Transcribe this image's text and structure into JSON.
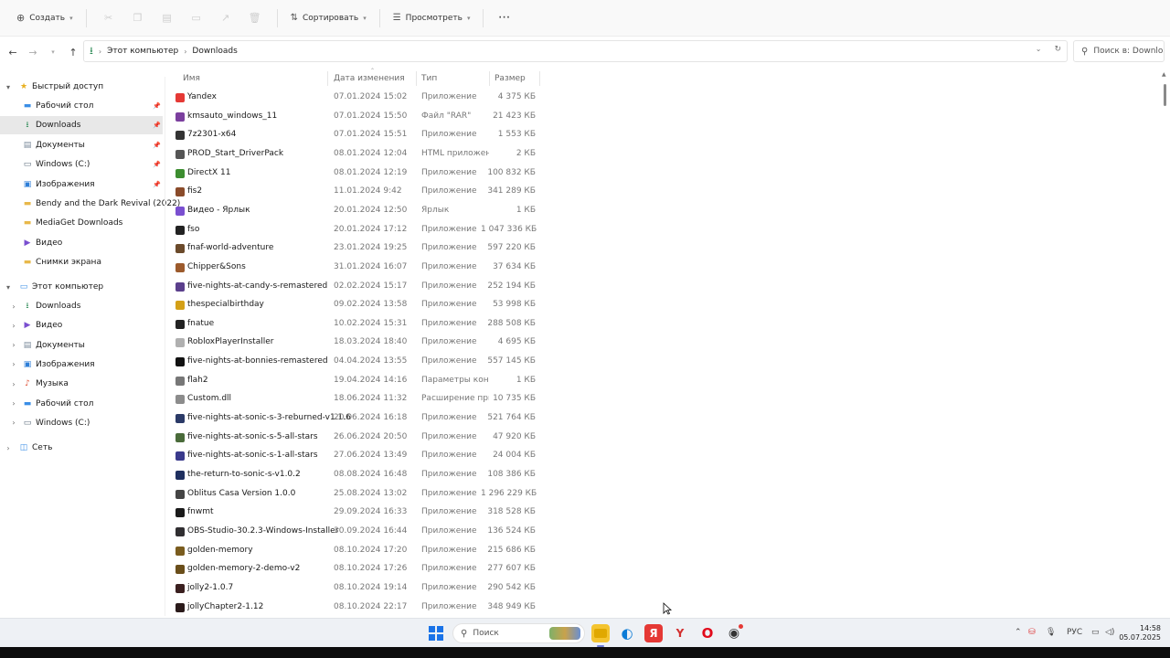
{
  "toolbar": {
    "create_label": "Создать",
    "sort_label": "Сортировать",
    "view_label": "Просмотреть",
    "more_label": "···"
  },
  "address": {
    "crumbs": [
      "Этот компьютер",
      "Downloads"
    ],
    "search_placeholder": "Поиск в: Downloads"
  },
  "sidebar": {
    "quick_access": "Быстрый доступ",
    "quick_items": [
      {
        "label": "Рабочий стол",
        "icon": "desktop-icon"
      },
      {
        "label": "Downloads",
        "icon": "download-icon"
      },
      {
        "label": "Документы",
        "icon": "documents-icon"
      },
      {
        "label": "Windows (C:)",
        "icon": "drive-icon"
      },
      {
        "label": "Изображения",
        "icon": "pictures-icon"
      },
      {
        "label": "Bendy and the Dark Revival (2022)",
        "icon": "folder-icon"
      },
      {
        "label": "MediaGet Downloads",
        "icon": "folder-icon"
      },
      {
        "label": "Видео",
        "icon": "video-icon"
      },
      {
        "label": "Снимки экрана",
        "icon": "folder-icon"
      }
    ],
    "this_pc": "Этот компьютер",
    "pc_items": [
      {
        "label": "Downloads",
        "icon": "download-icon"
      },
      {
        "label": "Видео",
        "icon": "video-icon"
      },
      {
        "label": "Документы",
        "icon": "documents-icon"
      },
      {
        "label": "Изображения",
        "icon": "pictures-icon"
      },
      {
        "label": "Музыка",
        "icon": "music-icon"
      },
      {
        "label": "Рабочий стол",
        "icon": "desktop-icon"
      },
      {
        "label": "Windows (C:)",
        "icon": "drive-icon"
      }
    ],
    "network": "Сеть"
  },
  "columns": {
    "name": "Имя",
    "date": "Дата изменения",
    "type": "Тип",
    "size": "Размер"
  },
  "files": [
    {
      "name": "Yandex",
      "date": "07.01.2024 15:02",
      "type": "Приложение",
      "size": "4 375 КБ",
      "color": "#e53935"
    },
    {
      "name": "kmsauto_windows_11",
      "date": "07.01.2024 15:50",
      "type": "Файл \"RAR\"",
      "size": "21 423 КБ",
      "color": "#7b3f9e"
    },
    {
      "name": "7z2301-x64",
      "date": "07.01.2024 15:51",
      "type": "Приложение",
      "size": "1 553 КБ",
      "color": "#333333"
    },
    {
      "name": "PROD_Start_DriverPack",
      "date": "08.01.2024 12:04",
      "type": "HTML приложение",
      "size": "2 КБ",
      "color": "#555555"
    },
    {
      "name": "DirectX 11",
      "date": "08.01.2024 12:19",
      "type": "Приложение",
      "size": "100 832 КБ",
      "color": "#3c8d2f"
    },
    {
      "name": "fis2",
      "date": "11.01.2024 9:42",
      "type": "Приложение",
      "size": "341 289 КБ",
      "color": "#8a4b2a"
    },
    {
      "name": "Видео - Ярлык",
      "date": "20.01.2024 12:50",
      "type": "Ярлык",
      "size": "1 КБ",
      "color": "#7a4fd0"
    },
    {
      "name": "fso",
      "date": "20.01.2024 17:12",
      "type": "Приложение",
      "size": "1 047 336 КБ",
      "color": "#222222"
    },
    {
      "name": "fnaf-world-adventure",
      "date": "23.01.2024 19:25",
      "type": "Приложение",
      "size": "597 220 КБ",
      "color": "#6b4a2b"
    },
    {
      "name": "Chipper&Sons",
      "date": "31.01.2024 16:07",
      "type": "Приложение",
      "size": "37 634 КБ",
      "color": "#9c5a2c"
    },
    {
      "name": "five-nights-at-candy-s-remastered",
      "date": "02.02.2024 15:17",
      "type": "Приложение",
      "size": "252 194 КБ",
      "color": "#5b3f8c"
    },
    {
      "name": "thespecialbirthday",
      "date": "09.02.2024 13:58",
      "type": "Приложение",
      "size": "53 998 КБ",
      "color": "#d4a017"
    },
    {
      "name": "fnatue",
      "date": "10.02.2024 15:31",
      "type": "Приложение",
      "size": "288 508 КБ",
      "color": "#222222"
    },
    {
      "name": "RobloxPlayerInstaller",
      "date": "18.03.2024 18:40",
      "type": "Приложение",
      "size": "4 695 КБ",
      "color": "#b0b0b0"
    },
    {
      "name": "five-nights-at-bonnies-remastered",
      "date": "04.04.2024 13:55",
      "type": "Приложение",
      "size": "557 145 КБ",
      "color": "#111111"
    },
    {
      "name": "flah2",
      "date": "19.04.2024 14:16",
      "type": "Параметры конф...",
      "size": "1 КБ",
      "color": "#777777"
    },
    {
      "name": "Custom.dll",
      "date": "18.06.2024 11:32",
      "type": "Расширение при...",
      "size": "10 735 КБ",
      "color": "#8c8c8c"
    },
    {
      "name": "five-nights-at-sonic-s-3-reburned-v1.1.6",
      "date": "20.06.2024 16:18",
      "type": "Приложение",
      "size": "521 764 КБ",
      "color": "#2b3a67"
    },
    {
      "name": "five-nights-at-sonic-s-5-all-stars",
      "date": "26.06.2024 20:50",
      "type": "Приложение",
      "size": "47 920 КБ",
      "color": "#4a6b3a"
    },
    {
      "name": "five-nights-at-sonic-s-1-all-stars",
      "date": "27.06.2024 13:49",
      "type": "Приложение",
      "size": "24 004 КБ",
      "color": "#3a3a8c"
    },
    {
      "name": "the-return-to-sonic-s-v1.0.2",
      "date": "08.08.2024 16:48",
      "type": "Приложение",
      "size": "108 386 КБ",
      "color": "#1f2f5f"
    },
    {
      "name": "Oblitus Casa Version 1.0.0",
      "date": "25.08.2024 13:02",
      "type": "Приложение",
      "size": "1 296 229 КБ",
      "color": "#444444"
    },
    {
      "name": "fnwmt",
      "date": "29.09.2024 16:33",
      "type": "Приложение",
      "size": "318 528 КБ",
      "color": "#1a1a1a"
    },
    {
      "name": "OBS-Studio-30.2.3-Windows-Installer",
      "date": "30.09.2024 16:44",
      "type": "Приложение",
      "size": "136 524 КБ",
      "color": "#302e31"
    },
    {
      "name": "golden-memory",
      "date": "08.10.2024 17:20",
      "type": "Приложение",
      "size": "215 686 КБ",
      "color": "#7a5c1e"
    },
    {
      "name": "golden-memory-2-demo-v2",
      "date": "08.10.2024 17:26",
      "type": "Приложение",
      "size": "277 607 КБ",
      "color": "#6a4e1a"
    },
    {
      "name": "jolly2-1.0.7",
      "date": "08.10.2024 19:14",
      "type": "Приложение",
      "size": "290 542 КБ",
      "color": "#3a1f1f"
    },
    {
      "name": "jollyChapter2-1.12",
      "date": "08.10.2024 22:17",
      "type": "Приложение",
      "size": "348 949 КБ",
      "color": "#2a1a1a"
    }
  ],
  "taskbar": {
    "search_label": "Поиск",
    "lang": "РУС",
    "time": "14:58",
    "date": "05.07.2025"
  }
}
